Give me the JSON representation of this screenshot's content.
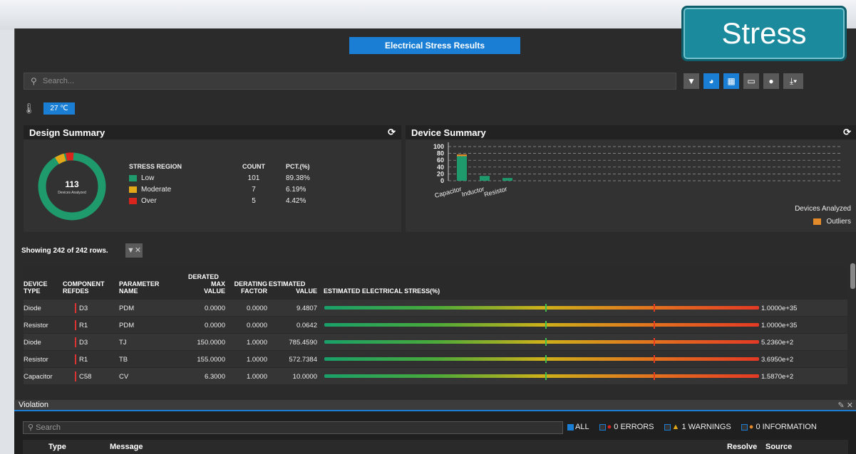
{
  "header": {
    "title": "Electrical Stress Results",
    "badge": "Stress"
  },
  "search": {
    "placeholder": "Search..."
  },
  "temperature": "27 ℃",
  "design_summary": {
    "title": "Design Summary",
    "donut": {
      "count": "113",
      "label": "Devices Analyzed"
    },
    "table": {
      "headers": [
        "STRESS REGION",
        "COUNT",
        "PCT.(%)"
      ],
      "rows": [
        {
          "region": "Low",
          "count": "101",
          "pct": "89.38%",
          "color": "#1f9a6c"
        },
        {
          "region": "Moderate",
          "count": "7",
          "pct": "6.19%",
          "color": "#e3a817"
        },
        {
          "region": "Over",
          "count": "5",
          "pct": "4.42%",
          "color": "#d9231d"
        }
      ]
    }
  },
  "device_summary": {
    "title": "Device Summary",
    "legend": {
      "analyzed": "Devices Analyzed",
      "outliers": "Outliers"
    }
  },
  "chart_data": {
    "type": "bar",
    "categories": [
      "Capacitor",
      "Inductor",
      "Resistor"
    ],
    "series": [
      {
        "name": "Devices Analyzed",
        "values": [
          72,
          14,
          8
        ],
        "color": "#1f9a6c"
      },
      {
        "name": "Outliers",
        "values": [
          5,
          0,
          0
        ],
        "color": "#e38a2a"
      }
    ],
    "y_ticks": [
      "100",
      "80",
      "60",
      "40",
      "20",
      "0"
    ],
    "ylim": [
      0,
      100
    ],
    "grid": true,
    "legend_position": "bottom-right"
  },
  "rows_info": "Showing 242 of 242 rows.",
  "grid": {
    "headers": {
      "device": [
        "DEVICE",
        "TYPE"
      ],
      "refdes": [
        "COMPONENT",
        "REFDES"
      ],
      "param": [
        "PARAMETER",
        "NAME"
      ],
      "derated": [
        "DERATED",
        "MAX",
        "VALUE"
      ],
      "factor": [
        "DERATING",
        "FACTOR"
      ],
      "estimated": [
        "ESTIMATED",
        "VALUE"
      ],
      "stress": "ESTIMATED ELECTRICAL STRESS(%)"
    },
    "rows": [
      {
        "device": "Diode",
        "refdes": "D3",
        "param": "PDM",
        "derated": "0.0000",
        "factor": "0.0000",
        "est": "9.4807",
        "stress": "1.0000e+35"
      },
      {
        "device": "Resistor",
        "refdes": "R1",
        "param": "PDM",
        "derated": "0.0000",
        "factor": "0.0000",
        "est": "0.0642",
        "stress": "1.0000e+35"
      },
      {
        "device": "Diode",
        "refdes": "D3",
        "param": "TJ",
        "derated": "150.0000",
        "factor": "1.0000",
        "est": "785.4590",
        "stress": "5.2360e+2"
      },
      {
        "device": "Resistor",
        "refdes": "R1",
        "param": "TB",
        "derated": "155.0000",
        "factor": "1.0000",
        "est": "572.7384",
        "stress": "3.6950e+2"
      },
      {
        "device": "Capacitor",
        "refdes": "C58",
        "param": "CV",
        "derated": "6.3000",
        "factor": "1.0000",
        "est": "10.0000",
        "stress": "1.5870e+2"
      }
    ]
  },
  "violation": {
    "title": "Violation",
    "search_placeholder": "Search",
    "filters": {
      "all": "ALL",
      "errors": "0 ERRORS",
      "warnings": "1 WARNINGS",
      "info": "0 INFORMATION"
    },
    "headers": {
      "type": "Type",
      "message": "Message",
      "resolve": "Resolve",
      "source": "Source"
    }
  }
}
